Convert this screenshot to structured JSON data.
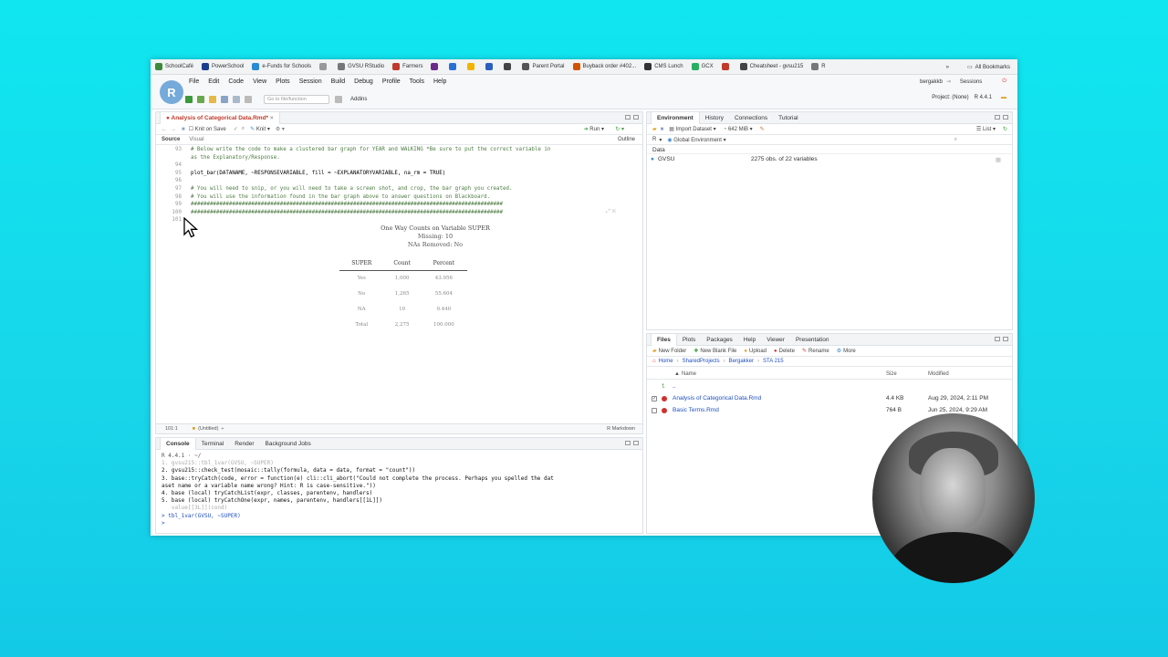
{
  "bookmarks": {
    "items": [
      {
        "label": "SchoolCafé",
        "color": "#3a8a3a"
      },
      {
        "label": "PowerSchool",
        "color": "#1b3f8f"
      },
      {
        "label": "e-Funds for Schools",
        "color": "#2a8ad4"
      },
      {
        "label": "",
        "color": "#999999"
      },
      {
        "label": "GVSU RStudio",
        "color": "#777777"
      },
      {
        "label": "Farmers",
        "color": "#c0392b"
      },
      {
        "label": "",
        "color": "#6b2a8c"
      },
      {
        "label": "",
        "color": "#2a6fd4"
      },
      {
        "label": "",
        "color": "#f0b400"
      },
      {
        "label": "",
        "color": "#2a5fbf"
      },
      {
        "label": "",
        "color": "#444444"
      },
      {
        "label": "Parent Portal",
        "color": "#555555"
      },
      {
        "label": "Buyback order #402...",
        "color": "#d35400"
      },
      {
        "label": "CMS Lunch",
        "color": "#333333"
      },
      {
        "label": "GCX",
        "color": "#27ae60"
      },
      {
        "label": "",
        "color": "#c0392b"
      },
      {
        "label": "Cheatsheet - gvsu215",
        "color": "#444444"
      },
      {
        "label": "R",
        "color": "#777777"
      }
    ],
    "all_bookmarks": "All Bookmarks"
  },
  "rstudio": {
    "logo": "R",
    "menu": [
      "File",
      "Edit",
      "Code",
      "View",
      "Plots",
      "Session",
      "Build",
      "Debug",
      "Profile",
      "Tools",
      "Help"
    ],
    "goto_placeholder": "Go to file/function",
    "addins": "Addins",
    "user": "bergakkb",
    "sessions": "Sessions",
    "project": "Project: (None)",
    "r_version": "R 4.4.1"
  },
  "editor": {
    "tab": "Analysis of Categorical Data.Rmd*",
    "knit_on_save": "Knit on Save",
    "knit": "Knit",
    "run": "Run",
    "outline": "Outline",
    "source_tab": "Source",
    "visual_tab": "Visual",
    "lines": [
      {
        "n": "93",
        "text": "# Below write the code to make a clustered bar graph for YEAR and WALKING *Be sure to put the correct variable in",
        "kind": "cm"
      },
      {
        "n": "",
        "text": "as the Explanatory/Response.",
        "kind": "cm"
      },
      {
        "n": "94",
        "text": "",
        "kind": "fn"
      },
      {
        "n": "95",
        "text": "plot_bar(DATANAME, ~RESPONSEVARIABLE, fill = ~EXPLANATORYVARIABLE, na_rm = TRUE)",
        "kind": "fn"
      },
      {
        "n": "96",
        "text": "",
        "kind": "fn"
      },
      {
        "n": "97",
        "text": "# You will need to snip, or you will need to take a screen shot, and crop, the bar graph you created.",
        "kind": "cm"
      },
      {
        "n": "98",
        "text": "# You will use the information found in the bar graph above to answer questions on Blackboard.",
        "kind": "cm"
      },
      {
        "n": "99",
        "text": "##################################################################################################",
        "kind": "cm"
      },
      {
        "n": "100",
        "text": "##################################################################################################",
        "kind": "cm"
      },
      {
        "n": "101",
        "text": "",
        "kind": "fn"
      }
    ],
    "output": {
      "title": "One Way Counts on Variable SUPER",
      "missing": "Missing: 10",
      "nas_removed": "NAs Removed: No",
      "headers": [
        "SUPER",
        "Count",
        "Percent"
      ],
      "rows": [
        [
          "Yes",
          "1,000",
          "43.956"
        ],
        [
          "No",
          "1,265",
          "55.604"
        ],
        [
          "NA",
          "10",
          "0.440"
        ],
        [
          "Total",
          "2,275",
          "100.000"
        ]
      ]
    },
    "status_pos": "101:1",
    "status_chunk": "(Untitled)",
    "status_mode": "R Markdown"
  },
  "console": {
    "tabs": [
      "Console",
      "Terminal",
      "Render",
      "Background Jobs"
    ],
    "r_label": "R 4.4.1 · ~/",
    "lines": [
      {
        "text": "1. gvsu215::tbl_1var(GVSU, ~SUPER)",
        "kind": "muted"
      },
      {
        "text": "2. gvsu215::check_test(mosaic::tally(formula, data = data, format = \"count\"))",
        "kind": "plain"
      },
      {
        "text": "3. base::tryCatch(code, error = function(e) cli::cli_abort(\"Could not complete the process. Perhaps you spelled the dat",
        "kind": "plain"
      },
      {
        "text": "aset name or a variable name wrong? Hint: R is case-sensitive.\"))",
        "kind": "plain"
      },
      {
        "text": "4. base (local) tryCatchList(expr, classes, parentenv, handlers)",
        "kind": "plain"
      },
      {
        "text": "5. base (local) tryCatchOne(expr, names, parentenv, handlers[[1L]])",
        "kind": "plain"
      },
      {
        "text": "   value[[3L]](cond)",
        "kind": "muted"
      },
      {
        "text": "> tbl_1var(GVSU, ~SUPER)",
        "kind": "blue"
      },
      {
        "text": ">",
        "kind": "blue"
      }
    ]
  },
  "environment": {
    "tabs": [
      "Environment",
      "History",
      "Connections",
      "Tutorial"
    ],
    "import": "Import Dataset",
    "memory": "642 MiB",
    "list_mode": "List",
    "lang": "R",
    "scope": "Global Environment",
    "section": "Data",
    "objects": [
      {
        "name": "GVSU",
        "desc": "2275 obs. of 22 variables"
      }
    ]
  },
  "files": {
    "tabs": [
      "Files",
      "Plots",
      "Packages",
      "Help",
      "Viewer",
      "Presentation"
    ],
    "actions": [
      "New Folder",
      "New Blank File",
      "Upload",
      "Delete",
      "Rename",
      "More"
    ],
    "breadcrumb": [
      "Home",
      "SharedProjects",
      "Bergakker",
      "STA 215"
    ],
    "col_name": "Name",
    "col_size": "Size",
    "col_modified": "Modified",
    "up_dir": "..",
    "rows": [
      {
        "name": "Analysis of Categorical Data.Rmd",
        "size": "4.4 KB",
        "modified": "Aug 29, 2024, 2:11 PM",
        "checked": true
      },
      {
        "name": "Basic Terms.Rmd",
        "size": "764 B",
        "modified": "Jun 25, 2024, 9:29 AM",
        "checked": false
      }
    ]
  }
}
